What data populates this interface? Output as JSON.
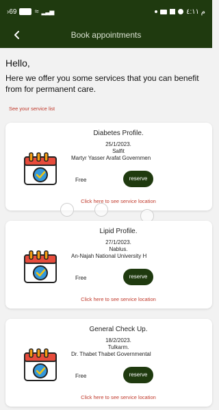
{
  "status_bar": {
    "left_text": "›69",
    "battery_label": "",
    "right_text": "ﻡ ٤:١١"
  },
  "app_bar": {
    "title": "Book appointments",
    "back_icon": "chevron-left-icon"
  },
  "intro": {
    "greeting": "Hello,",
    "message": "Here we offer you some services that you can benefit from for permanent care.",
    "service_list_link": "See your service list"
  },
  "cards": [
    {
      "title": "Diabetes Profile.",
      "date": "25/1/2023.",
      "city": "Salfit",
      "place": "Martyr Yasser Arafat Governmen",
      "price": "Free",
      "reserve_label": "reserve",
      "location_link": "Click here to see service location"
    },
    {
      "title": "Lipid Profile.",
      "date": "27/1/2023.",
      "city": "Nablus.",
      "place": "An-Najah National University H",
      "price": "Free",
      "reserve_label": "reserve",
      "location_link": "Click here to see service location"
    },
    {
      "title": "General Check Up.",
      "date": "18/2/2023.",
      "city": "Tulkarm.",
      "place": "Dr. Thabet Thabet Governmental",
      "price": "Free",
      "reserve_label": "reserve",
      "location_link": "Click here to see service location"
    }
  ],
  "colors": {
    "brand": "#1f3a0f",
    "link": "#c0392b"
  }
}
